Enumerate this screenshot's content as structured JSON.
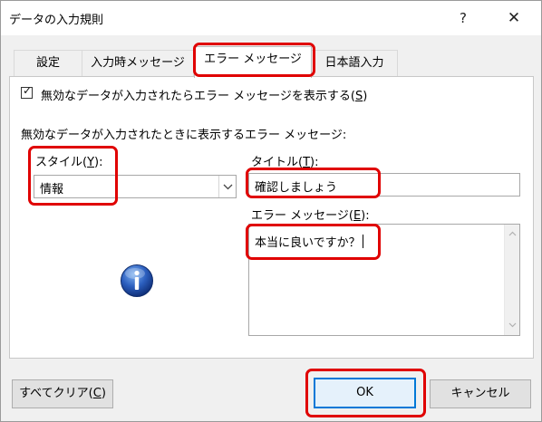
{
  "window": {
    "title": "データの入力規則",
    "help_label": "?",
    "close_label": "✕"
  },
  "tabs": [
    {
      "label": "設定"
    },
    {
      "label": "入力時メッセージ"
    },
    {
      "label": "エラー メッセージ",
      "active": true
    },
    {
      "label": "日本語入力"
    }
  ],
  "error_tab": {
    "show_error_checkbox": {
      "checked": true,
      "label_prefix": "無効なデータが入力されたらエラー メッセージを表示する(",
      "mnemonic": "S",
      "label_suffix": ")"
    },
    "section_heading": "無効なデータが入力されたときに表示するエラー メッセージ:",
    "style": {
      "label_prefix": "スタイル(",
      "mnemonic": "Y",
      "label_suffix": "):",
      "selected": "情報"
    },
    "title": {
      "label_prefix": "タイトル(",
      "mnemonic": "T",
      "label_suffix": "):",
      "value": "確認しましょう"
    },
    "message": {
      "label_prefix": "エラー メッセージ(",
      "mnemonic": "E",
      "label_suffix": "):",
      "value": "本当に良いですか？"
    },
    "style_icon": "information-icon"
  },
  "footer": {
    "clear_all": {
      "label_prefix": "すべてクリア(",
      "mnemonic": "C",
      "label_suffix": ")"
    },
    "ok_label": "OK",
    "cancel_label": "キャンセル"
  },
  "colors": {
    "highlight": "#e00000",
    "accent": "#0078d7",
    "dialog_background": "#f0f0f0"
  }
}
